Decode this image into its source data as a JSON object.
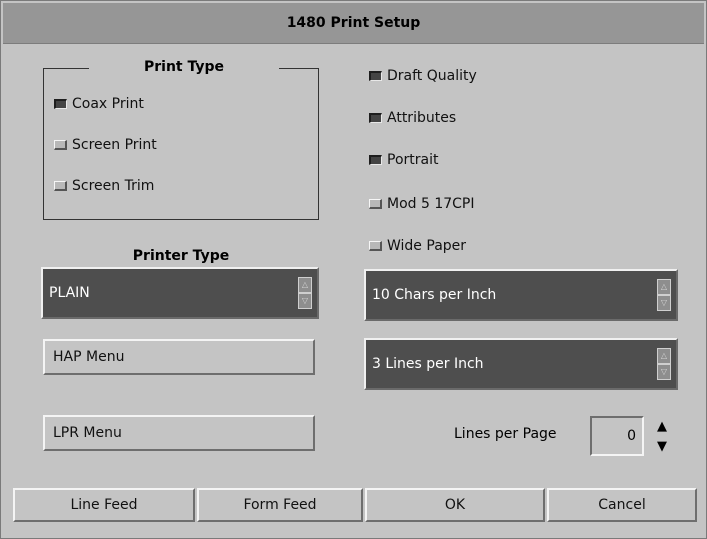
{
  "window": {
    "title": "1480 Print Setup"
  },
  "print_type": {
    "title": "Print Type",
    "options": [
      {
        "label": "Coax Print",
        "selected": true
      },
      {
        "label": "Screen Print",
        "selected": false
      },
      {
        "label": "Screen Trim",
        "selected": false
      }
    ]
  },
  "toggles": [
    {
      "label": "Draft Quality",
      "checked": true
    },
    {
      "label": "Attributes",
      "checked": true
    },
    {
      "label": "Portrait",
      "checked": true
    },
    {
      "label": "Mod 5 17CPI",
      "checked": false
    },
    {
      "label": "Wide Paper",
      "checked": false
    }
  ],
  "printer_type": {
    "title": "Printer Type",
    "value": "PLAIN"
  },
  "chars_per_inch": {
    "value": "10 Chars per Inch"
  },
  "lines_per_inch": {
    "value": "3 Lines per Inch"
  },
  "menus": {
    "hap": "HAP Menu",
    "lpr": "LPR Menu"
  },
  "lines_per_page": {
    "label": "Lines per Page",
    "value": "0"
  },
  "bottom_buttons": {
    "line_feed": "Line Feed",
    "form_feed": "Form Feed",
    "ok": "OK",
    "cancel": "Cancel"
  },
  "icons": {
    "spin_up": "▲",
    "spin_down": "▼",
    "small_up": "△",
    "small_down": "▽"
  },
  "colors": {
    "background": "#c4c4c4",
    "titlebar": "#969696",
    "field_dark": "#4e4e4e"
  }
}
